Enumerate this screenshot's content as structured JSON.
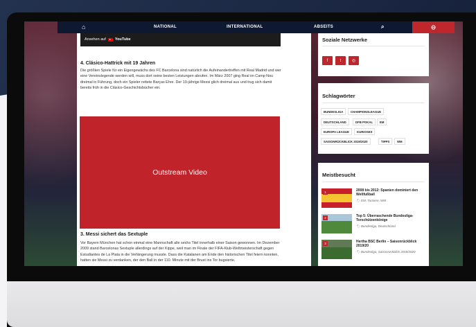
{
  "nav": {
    "home_icon": "home-icon",
    "items": [
      "NATIONAL",
      "INTERNATIONAL",
      "ABSEITS"
    ],
    "search_icon": "search-icon",
    "globe_icon": "globe-icon"
  },
  "video_embed": {
    "label": "Ansehen auf",
    "brand": "YouTube"
  },
  "article": {
    "section4_title": "4. Clásico-Hattrick mit 19 Jahren",
    "section4_text": "Die größten Spiele für ein Eigengewächs des FC Barcelona sind natürlich die Aufeinandertreffen mit Real Madrid und wer eine Vereinslegende werden will, muss dort seine besten Leistungen abrufen. Im März 2007 ging Real im Camp Nou dreimal in Führung, doch ein Spieler rettete Barças Ehre. Der 19-jährige Messi glich dreimal aus und trug sich damit bereits früh in die Clásico-Geschichtsbücher ein.",
    "video_label": "Outstream Video",
    "section3_title": "3. Messi sichert das Sextuple",
    "section3_text": "Vor Bayern München hat schon einmal eine Mannschaft alle sechs Titel innerhalb einer Saison gewonnen. Im Dezember 2009 stand Barcelonas Sextuple allerdings auf der Kippe, weil man im Finale der FIFA-Klub-Weltmeisterschaft gegen Estudiantes de La Plata in die Verlängerung musste. Dass die Katalanen am Ende den historischen Titel feiern konnten, hatten sie Messi zu verdanken, der den Ball in der 110. Minute mit der Brust ins Tor bugsierte."
  },
  "sidebar": {
    "social_title": "Soziale Netzwerke",
    "social_icons": [
      "facebook-icon",
      "twitter-icon",
      "instagram-icon"
    ],
    "tags_title": "Schlagwörter",
    "tags": [
      "BUNDESLIGA",
      "CHAMPIONSLEAGUE",
      "DEUTSCHLAND",
      "DFB POKAL",
      "EM",
      "EUROPA LEAGUE",
      "KURIOSES",
      "SAISONRÜCKBLICK 2019/2020",
      "TIPPS",
      "WM"
    ],
    "popular_title": "Meistbesucht",
    "popular": [
      {
        "rank": "1",
        "title": "2008 bis 2012: Spanien dominiert den Weltfußball",
        "meta": "EM, Turniere, WM"
      },
      {
        "rank": "2",
        "title": "Top 5: Überraschende Bundesliga-Torschützenkönige",
        "meta": "Bundesliga, Deutschland"
      },
      {
        "rank": "3",
        "title": "Hertha BSC Berlin – Saisonrückblick 2019/20",
        "meta": "Bundesliga, Saisonrückblick 2019/2020"
      }
    ]
  },
  "colors": {
    "accent": "#c0272d",
    "nav": "#0e1830"
  }
}
